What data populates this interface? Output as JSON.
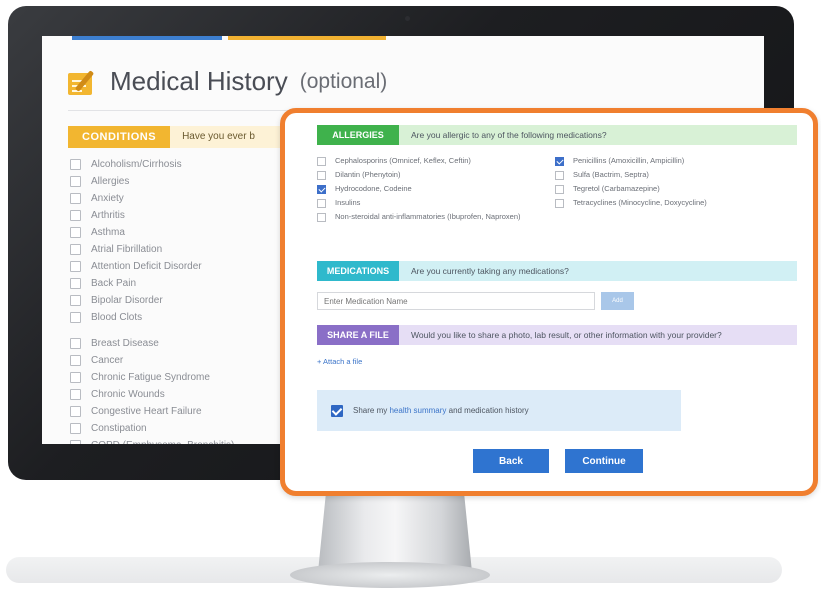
{
  "history": {
    "title": "Medical History",
    "subtitle": "(optional)",
    "conditions_label": "CONDITIONS",
    "conditions_question": "Have you ever b",
    "conditions": [
      "Alcoholism/Cirrhosis",
      "Allergies",
      "Anxiety",
      "Arthritis",
      "Asthma",
      "Atrial Fibrillation",
      "Attention Deficit Disorder",
      "Back Pain",
      "Bipolar Disorder",
      "Blood Clots",
      "Breast Disease",
      "Cancer",
      "Chronic Fatigue Syndrome",
      "Chronic Wounds",
      "Congestive Heart Failure",
      "Constipation",
      "COPD (Emphysema, Bronchitis)"
    ]
  },
  "modal": {
    "allergies": {
      "label": "ALLERGIES",
      "question": "Are you allergic to any of the following medications?",
      "left": [
        {
          "label": "Cephalosporins (Omnicef, Keflex, Ceftin)",
          "checked": false
        },
        {
          "label": "Dilantin (Phenytoin)",
          "checked": false
        },
        {
          "label": "Hydrocodone, Codeine",
          "checked": true
        },
        {
          "label": "Insulins",
          "checked": false
        },
        {
          "label": "Non-steroidal anti-inflammatories (Ibuprofen, Naproxen)",
          "checked": false
        }
      ],
      "right": [
        {
          "label": "Penicillins (Amoxicillin, Ampicillin)",
          "checked": true
        },
        {
          "label": "Sulfa (Bactrim, Septra)",
          "checked": false
        },
        {
          "label": "Tegretol (Carbamazepine)",
          "checked": false
        },
        {
          "label": "Tetracyclines (Minocycline, Doxycycline)",
          "checked": false
        }
      ]
    },
    "medications": {
      "label": "MEDICATIONS",
      "question": "Are you currently taking any medications?",
      "input_placeholder": "Enter Medication Name",
      "add_label": "Add"
    },
    "share": {
      "label": "SHARE A FILE",
      "question": "Would you like to share a photo, lab result, or other information with your provider?",
      "attach_label": "+ Attach a file"
    },
    "summary": {
      "checked": true,
      "text_before": "Share my ",
      "link": "health summary",
      "text_after": " and medication history"
    },
    "back_label": "Back",
    "continue_label": "Continue"
  },
  "colors": {
    "accent_orange": "#f07f2f",
    "allergies_green": "#3fb24c",
    "medications_teal": "#2fb9cc",
    "share_purple": "#8a6fc7",
    "conditions_yellow": "#f2b630",
    "button_blue": "#2f74d0"
  },
  "icons": {
    "title_icon": "notepad-pencil-icon"
  }
}
